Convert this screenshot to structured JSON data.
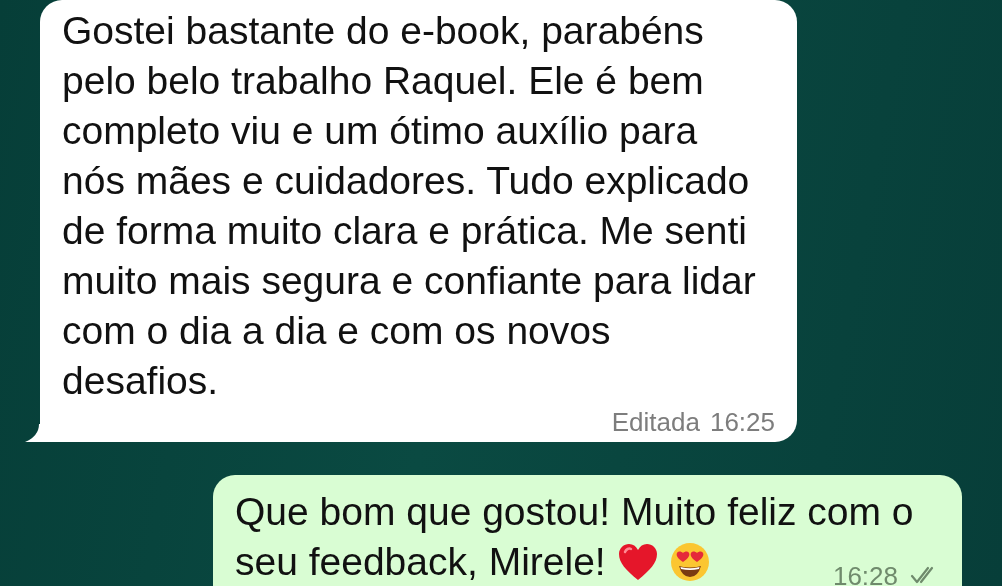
{
  "messages": [
    {
      "kind": "incoming",
      "text": "Gostei bastante do e-book, parabéns\npelo belo trabalho Raquel. Ele é bem\ncompleto viu e um ótimo auxílio para\nnós mães e cuidadores. Tudo explicado\nde forma muito clara e prática. Me senti\nmuito mais segura e confiante para lidar\ncom o dia a dia e com os novos\ndesafios.",
      "edited_label": "Editada",
      "time": "16:25"
    },
    {
      "kind": "outgoing",
      "lines": [
        "Que bom que gostou! Muito feliz com o",
        "seu feedback, Mirele!"
      ],
      "emojis": [
        {
          "kind": "heart"
        },
        {
          "kind": "heart-eyes"
        }
      ],
      "time": "16:28",
      "read": false
    }
  ]
}
